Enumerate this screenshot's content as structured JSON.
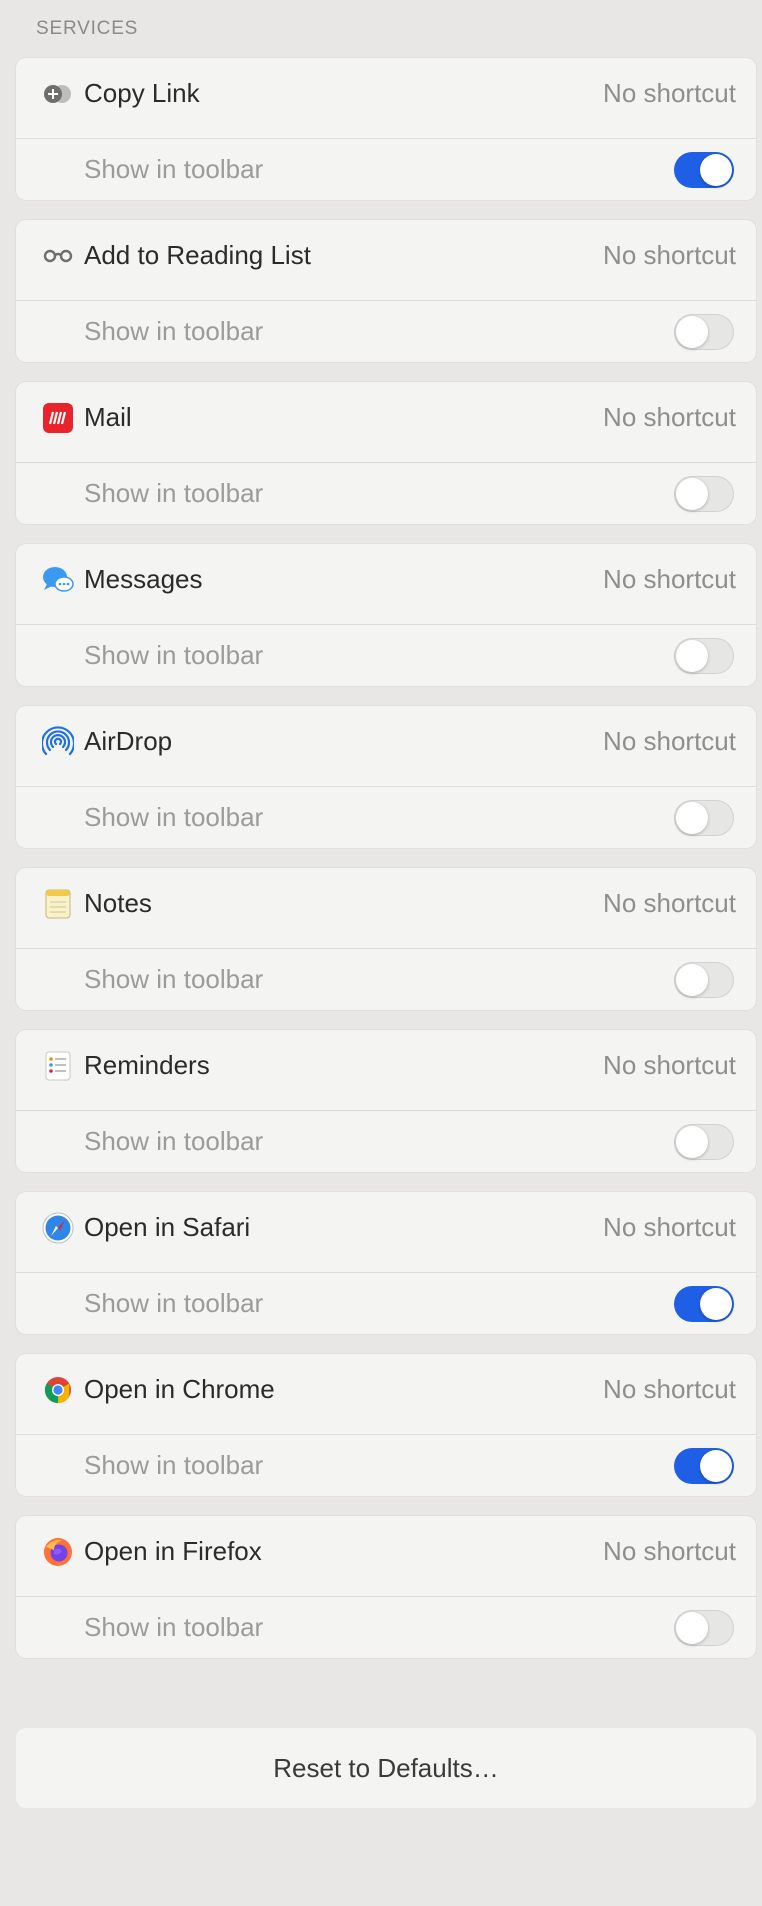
{
  "section_title": "SERVICES",
  "services": [
    {
      "name": "Copy Link",
      "shortcut": "No shortcut",
      "toolbar_label": "Show in toolbar",
      "show_in_toolbar": true,
      "icon": "copy-link-icon"
    },
    {
      "name": "Add to Reading List",
      "shortcut": "No shortcut",
      "toolbar_label": "Show in toolbar",
      "show_in_toolbar": false,
      "icon": "reading-glasses-icon"
    },
    {
      "name": "Mail",
      "shortcut": "No shortcut",
      "toolbar_label": "Show in toolbar",
      "show_in_toolbar": false,
      "icon": "mail-icon"
    },
    {
      "name": "Messages",
      "shortcut": "No shortcut",
      "toolbar_label": "Show in toolbar",
      "show_in_toolbar": false,
      "icon": "messages-icon"
    },
    {
      "name": "AirDrop",
      "shortcut": "No shortcut",
      "toolbar_label": "Show in toolbar",
      "show_in_toolbar": false,
      "icon": "airdrop-icon"
    },
    {
      "name": "Notes",
      "shortcut": "No shortcut",
      "toolbar_label": "Show in toolbar",
      "show_in_toolbar": false,
      "icon": "notes-icon"
    },
    {
      "name": "Reminders",
      "shortcut": "No shortcut",
      "toolbar_label": "Show in toolbar",
      "show_in_toolbar": false,
      "icon": "reminders-icon"
    },
    {
      "name": "Open in Safari",
      "shortcut": "No shortcut",
      "toolbar_label": "Show in toolbar",
      "show_in_toolbar": true,
      "icon": "safari-icon"
    },
    {
      "name": "Open in Chrome",
      "shortcut": "No shortcut",
      "toolbar_label": "Show in toolbar",
      "show_in_toolbar": true,
      "icon": "chrome-icon"
    },
    {
      "name": "Open in Firefox",
      "shortcut": "No shortcut",
      "toolbar_label": "Show in toolbar",
      "show_in_toolbar": false,
      "icon": "firefox-icon"
    }
  ],
  "reset_label": "Reset to Defaults…",
  "colors": {
    "toggle_on": "#1f5fe6",
    "background": "#e8e7e5",
    "card": "#f4f4f2"
  }
}
